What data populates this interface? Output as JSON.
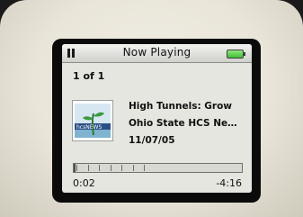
{
  "status_bar": {
    "title": "Now Playing",
    "play_state_icon": "pause-icon",
    "battery_icon": "battery-icon",
    "battery_color": "#3fbf35"
  },
  "now_playing": {
    "position": "1 of 1",
    "track_title": "High Tunnels: Grow",
    "artist": "Ohio State HCS Ne…",
    "date": "11/07/05",
    "album_art_icon": "podcast-artwork-icon",
    "artwork_text": "hcsNEWS"
  },
  "playback": {
    "elapsed": "0:02",
    "remaining": "-4:16",
    "progress_fraction": 0.01
  }
}
